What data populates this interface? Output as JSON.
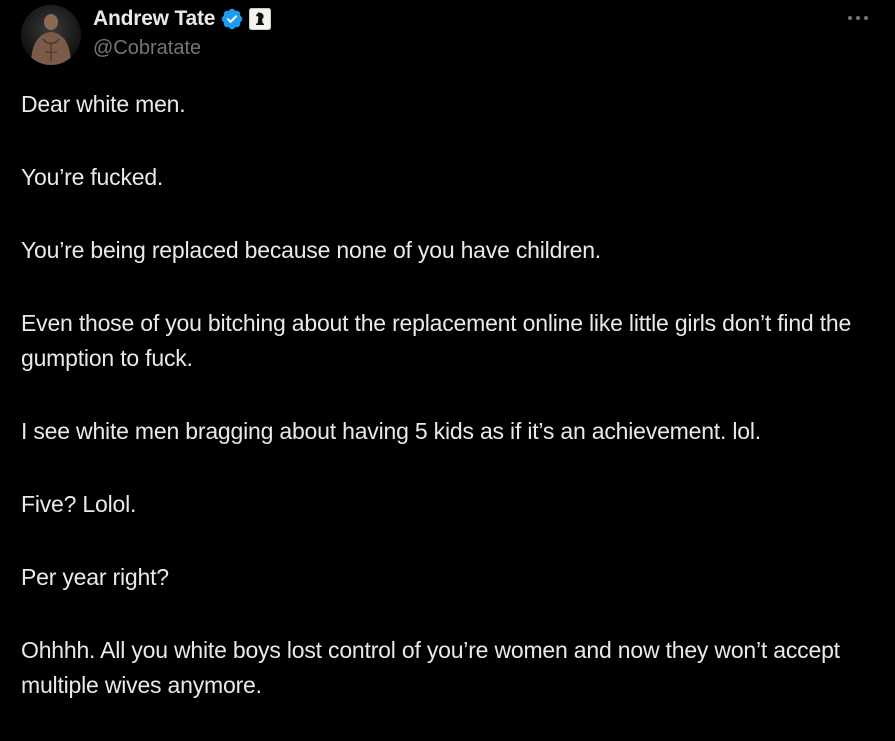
{
  "author": {
    "display_name": "Andrew Tate",
    "handle": "@Cobratate",
    "verified_badge_icon": "verified-badge-icon",
    "affiliate_badge_icon": "chess-piece-affiliate-icon",
    "avatar_icon": "user-avatar",
    "verified_color": "#1d9bf0"
  },
  "menu": {
    "more_icon": "more-options-icon"
  },
  "tweet": {
    "paragraphs": [
      "Dear white men.",
      "You’re fucked.",
      "You’re being replaced because none of you have children.",
      "Even those of you bitching about the replacement online like little girls don’t find the gumption to fuck.",
      "I see white men bragging about having 5 kids as if it’s an achievement. lol.",
      "Five? Lolol.",
      "Per year right?",
      "Ohhhh. All you white boys lost control of you’re women and now they won’t accept multiple wives anymore."
    ]
  },
  "colors": {
    "background": "#000000",
    "text_primary": "#e7e9ea",
    "text_secondary": "#71767b"
  }
}
